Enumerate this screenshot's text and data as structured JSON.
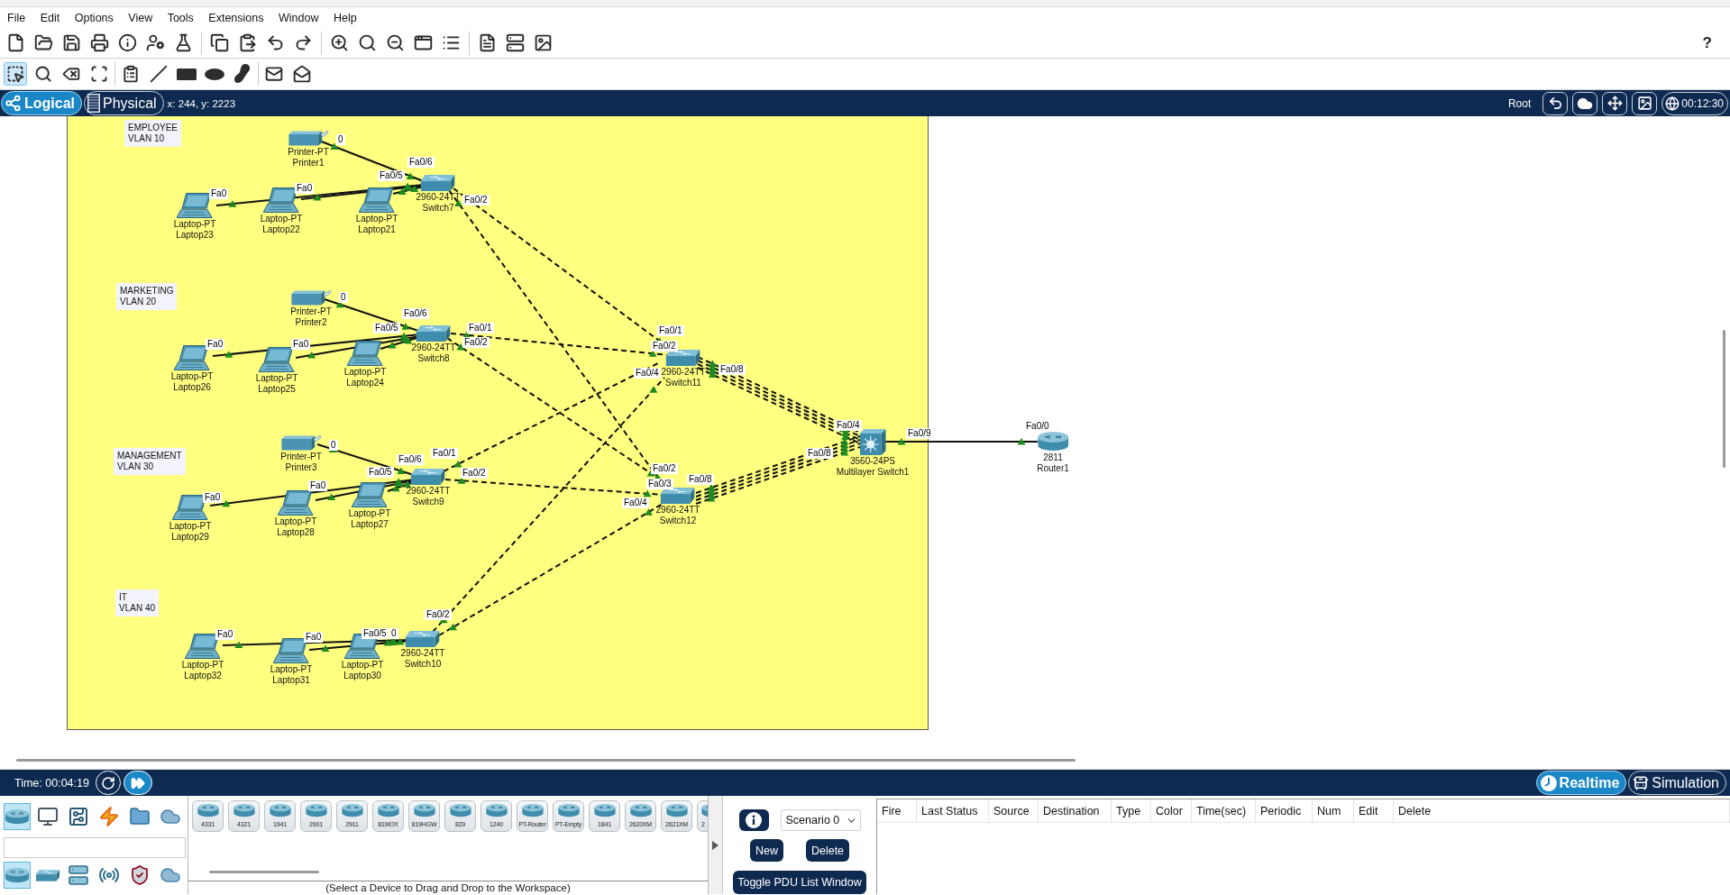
{
  "menu": [
    "File",
    "Edit",
    "Options",
    "View",
    "Tools",
    "Extensions",
    "Window",
    "Help"
  ],
  "help": "?",
  "edit_tools": [
    {
      "selected": true
    },
    {
      "selected": false
    },
    {
      "selected": false
    },
    {
      "selected": false
    },
    {
      "selected": false
    },
    {
      "selected": false
    },
    {
      "selected": false
    },
    {
      "selected": false
    },
    {
      "selected": false
    },
    {
      "selected": false
    },
    {
      "selected": false
    }
  ],
  "workspace_tabs": [
    {
      "label": "Logical",
      "selected": true
    },
    {
      "label": "Physical",
      "selected": false
    }
  ],
  "cursor_position": "x: 244, y: 2223",
  "root_label": "Root",
  "clock": "00:12:30",
  "canvas": {
    "notes": [
      {
        "lines": [
          "EMPLOYEE",
          "VLAN 10"
        ]
      },
      {
        "lines": [
          "MARKETING",
          "VLAN 20"
        ]
      },
      {
        "lines": [
          "MANAGEMENT",
          "VLAN 30"
        ]
      },
      {
        "lines": [
          "IT",
          "VLAN 40"
        ]
      }
    ],
    "devices": [
      {
        "kind": "printer",
        "model": "Printer-PT",
        "name": "Printer1"
      },
      {
        "kind": "laptop",
        "model": "Laptop-PT",
        "name": "Laptop23"
      },
      {
        "kind": "laptop",
        "model": "Laptop-PT",
        "name": "Laptop22"
      },
      {
        "kind": "laptop",
        "model": "Laptop-PT",
        "name": "Laptop21"
      },
      {
        "kind": "switch",
        "model": "2960-24TT",
        "name": "Switch7"
      },
      {
        "kind": "printer",
        "model": "Printer-PT",
        "name": "Printer2"
      },
      {
        "kind": "laptop",
        "model": "Laptop-PT",
        "name": "Laptop26"
      },
      {
        "kind": "laptop",
        "model": "Laptop-PT",
        "name": "Laptop25"
      },
      {
        "kind": "laptop",
        "model": "Laptop-PT",
        "name": "Laptop24"
      },
      {
        "kind": "switch",
        "model": "2960-24TT",
        "name": "Switch8"
      },
      {
        "kind": "switch",
        "model": "2960-24TT",
        "name": "Switch11"
      },
      {
        "kind": "printer",
        "model": "Printer-PT",
        "name": "Printer3"
      },
      {
        "kind": "laptop",
        "model": "Laptop-PT",
        "name": "Laptop29"
      },
      {
        "kind": "laptop",
        "model": "Laptop-PT",
        "name": "Laptop28"
      },
      {
        "kind": "laptop",
        "model": "Laptop-PT",
        "name": "Laptop27"
      },
      {
        "kind": "switch",
        "model": "2960-24TT",
        "name": "Switch9"
      },
      {
        "kind": "switch",
        "model": "2960-24TT",
        "name": "Switch12"
      },
      {
        "kind": "multilayer-switch",
        "model": "3560-24PS",
        "name": "Multilayer Switch1"
      },
      {
        "kind": "router",
        "model": "2811",
        "name": "Router1"
      },
      {
        "kind": "laptop",
        "model": "Laptop-PT",
        "name": "Laptop32"
      },
      {
        "kind": "laptop",
        "model": "Laptop-PT",
        "name": "Laptop31"
      },
      {
        "kind": "laptop",
        "model": "Laptop-PT",
        "name": "Laptop30"
      },
      {
        "kind": "switch",
        "model": "2960-24TT",
        "name": "Switch10"
      }
    ],
    "links": [
      {
        "kind": "straight",
        "up": true
      },
      {
        "kind": "straight",
        "up": true
      },
      {
        "kind": "straight",
        "up": true
      },
      {
        "kind": "straight",
        "up": true
      },
      {
        "kind": "crossover",
        "up": true
      },
      {
        "kind": "crossover",
        "up": true
      },
      {
        "kind": "straight",
        "up": true
      },
      {
        "kind": "straight",
        "up": true
      },
      {
        "kind": "straight",
        "up": true
      },
      {
        "kind": "straight",
        "up": true
      },
      {
        "kind": "crossover",
        "up": true
      },
      {
        "kind": "crossover",
        "up": true
      },
      {
        "kind": "straight",
        "up": true
      },
      {
        "kind": "straight",
        "up": true
      },
      {
        "kind": "straight",
        "up": true
      },
      {
        "kind": "straight",
        "up": true
      },
      {
        "kind": "crossover",
        "up": true
      },
      {
        "kind": "crossover",
        "up": true
      },
      {
        "kind": "straight",
        "up": true
      },
      {
        "kind": "straight",
        "up": true
      },
      {
        "kind": "straight",
        "up": true
      },
      {
        "kind": "crossover",
        "up": true
      },
      {
        "kind": "crossover",
        "up": true
      },
      {
        "kind": "crossover",
        "up": true
      },
      {
        "kind": "crossover",
        "up": true
      },
      {
        "kind": "crossover",
        "up": true
      },
      {
        "kind": "crossover",
        "up": true
      },
      {
        "kind": "crossover",
        "up": true
      },
      {
        "kind": "crossover",
        "up": true
      },
      {
        "kind": "crossover",
        "up": true
      },
      {
        "kind": "crossover",
        "up": true
      },
      {
        "kind": "straight",
        "up": true
      }
    ],
    "port_labels": [
      "0",
      "Fa0/6",
      "Fa0/5",
      "Fa0",
      "Fa0",
      "Fa0/2",
      "0",
      "Fa0/6",
      "Fa0/5",
      "Fa0/1",
      "Fa0/1",
      "Fa0",
      "Fa0",
      "Fa0/2",
      "Fa0/2",
      "Fa0/4",
      "Fa0/8",
      "Fa0/4",
      "Fa0/9",
      "Fa0/0",
      "0",
      "Fa0/6",
      "Fa0/1",
      "Fa0/8",
      "Fa0/5",
      "Fa0/2",
      "Fa0/2",
      "Fa0",
      "Fa0/3",
      "Fa0/8",
      "Fa0",
      "Fa0/4",
      "Fa0/2",
      "Fa0",
      "Fa0",
      "Fa0/5",
      "0"
    ]
  },
  "time": "Time: 00:04:19",
  "modes": [
    {
      "label": "Realtime",
      "selected": true
    },
    {
      "label": "Simulation",
      "selected": false
    }
  ],
  "device_categories": [
    {
      "selected": true
    },
    {
      "selected": false
    },
    {
      "selected": false
    },
    {
      "selected": false
    },
    {
      "selected": false
    },
    {
      "selected": false
    }
  ],
  "device_types": [
    {
      "selected": true
    },
    {
      "selected": false
    },
    {
      "selected": false
    },
    {
      "selected": false
    },
    {
      "selected": false
    },
    {
      "selected": false
    }
  ],
  "device_models": [
    "4331",
    "4321",
    "1941",
    "2901",
    "2911",
    "819IOX",
    "819HGW",
    "829",
    "1240",
    "PT-Router",
    "PT-Empty",
    "1841",
    "2620XM",
    "2621XM",
    "2"
  ],
  "drag_hint": "(Select a Device to Drag and Drop to the Workspace)",
  "scenario": {
    "value": "Scenario 0",
    "buttons": [
      "New",
      "Delete"
    ],
    "toggle_button": "Toggle PDU List Window"
  },
  "pdu_table": {
    "columns": [
      "Fire",
      "Last Status",
      "Source",
      "Destination",
      "Type",
      "Color",
      "Time(sec)",
      "Periodic",
      "Num",
      "Edit",
      "Delete"
    ]
  }
}
